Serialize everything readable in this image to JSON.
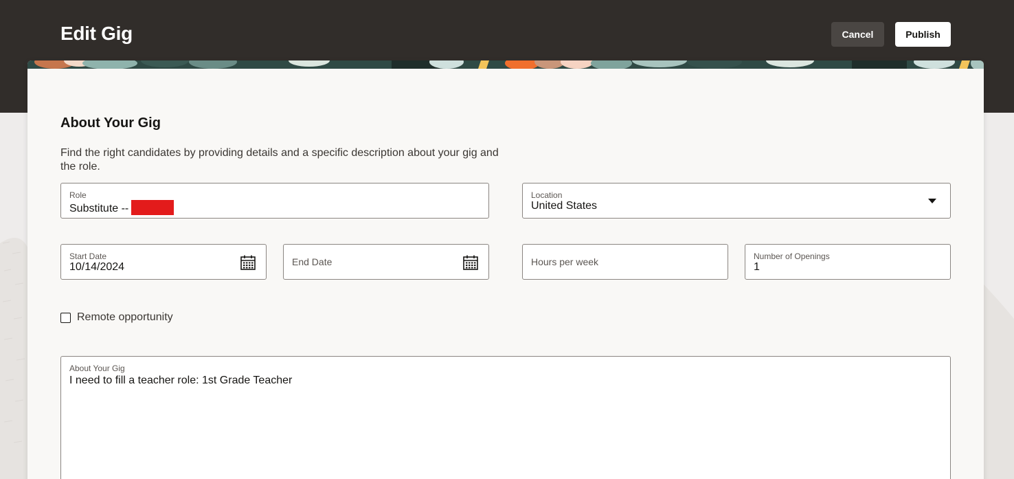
{
  "header": {
    "title": "Edit Gig",
    "cancel_label": "Cancel",
    "publish_label": "Publish"
  },
  "section": {
    "title": "About Your Gig",
    "description": "Find the right candidates by providing details and a specific description about your gig and the role."
  },
  "form": {
    "role": {
      "label": "Role",
      "value": "Substitute --"
    },
    "location": {
      "label": "Location",
      "value": "United States"
    },
    "start_date": {
      "label": "Start Date",
      "value": "10/14/2024"
    },
    "end_date": {
      "label": "End Date",
      "value": ""
    },
    "hours_per_week": {
      "label": "Hours per week",
      "value": ""
    },
    "openings": {
      "label": "Number of Openings",
      "value": "1"
    },
    "remote": {
      "label": "Remote opportunity",
      "checked": false
    },
    "about": {
      "label": "About Your Gig",
      "value": "I need to fill a teacher role: 1st Grade Teacher"
    }
  },
  "colors": {
    "header_bg": "#312d2a",
    "card_bg": "#f9f8f6",
    "redaction": "#e31b1b"
  },
  "icons": [
    "calendar-icon",
    "chevron-down-icon"
  ]
}
